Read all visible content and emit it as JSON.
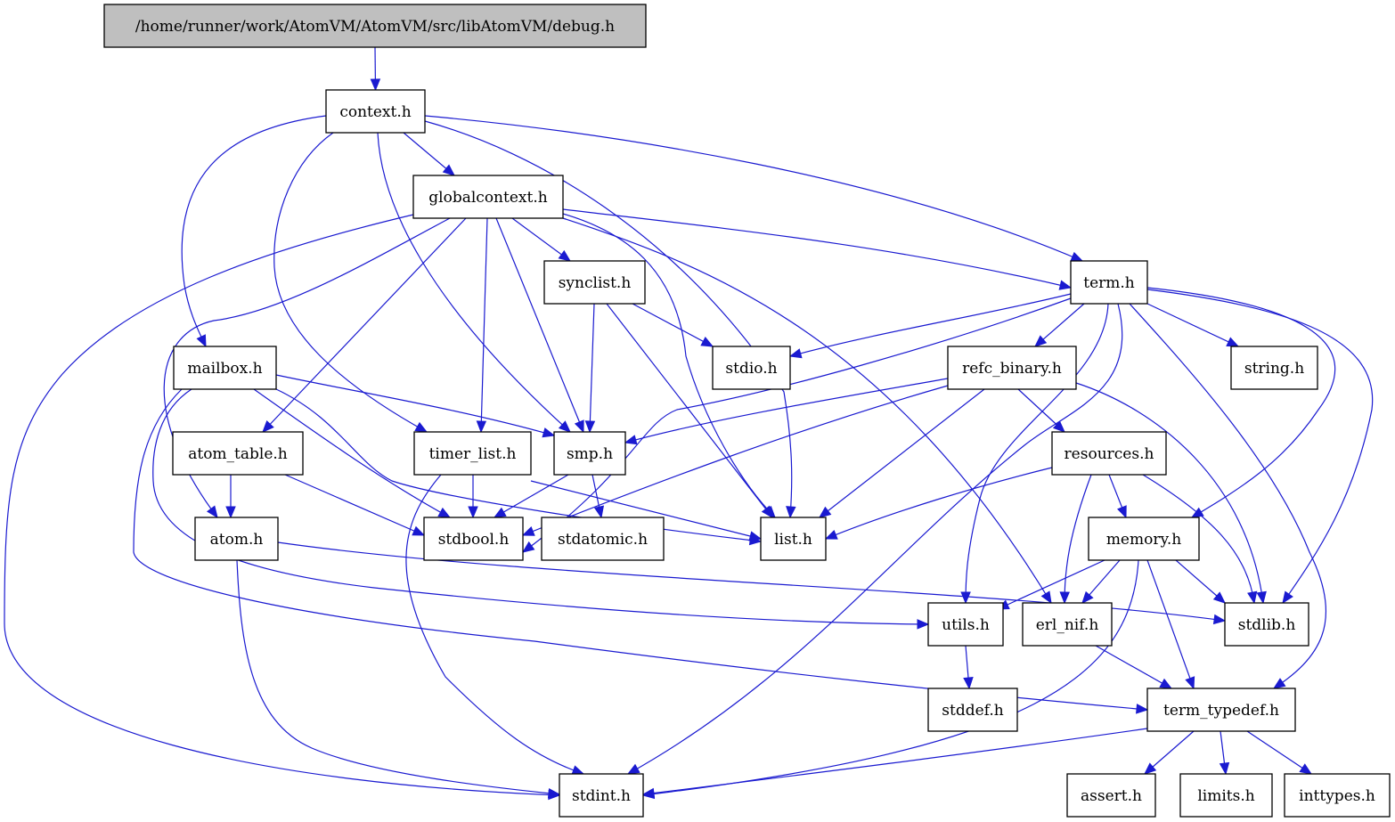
{
  "diagram": {
    "type": "include-dependency-graph",
    "root": "/home/runner/work/AtomVM/AtomVM/src/libAtomVM/debug.h",
    "colors": {
      "edge": "#1a1ad0",
      "root_fill": "#bfbfbf",
      "node_fill": "#ffffff",
      "node_border": "#000000"
    },
    "nodes": [
      {
        "id": "debug",
        "label": "/home/runner/work/AtomVM/AtomVM/src/libAtomVM/debug.h",
        "root": true
      },
      {
        "id": "context",
        "label": "context.h"
      },
      {
        "id": "globalcontext",
        "label": "globalcontext.h"
      },
      {
        "id": "term",
        "label": "term.h"
      },
      {
        "id": "synclist",
        "label": "synclist.h"
      },
      {
        "id": "mailbox",
        "label": "mailbox.h"
      },
      {
        "id": "stdio",
        "label": "stdio.h"
      },
      {
        "id": "refc_binary",
        "label": "refc_binary.h"
      },
      {
        "id": "string",
        "label": "string.h"
      },
      {
        "id": "atom_table",
        "label": "atom_table.h"
      },
      {
        "id": "timer_list",
        "label": "timer_list.h"
      },
      {
        "id": "smp",
        "label": "smp.h"
      },
      {
        "id": "resources",
        "label": "resources.h"
      },
      {
        "id": "atom",
        "label": "atom.h"
      },
      {
        "id": "stdbool",
        "label": "stdbool.h"
      },
      {
        "id": "stdatomic",
        "label": "stdatomic.h"
      },
      {
        "id": "list",
        "label": "list.h"
      },
      {
        "id": "memory",
        "label": "memory.h"
      },
      {
        "id": "utils",
        "label": "utils.h"
      },
      {
        "id": "erl_nif",
        "label": "erl_nif.h"
      },
      {
        "id": "stdlib",
        "label": "stdlib.h"
      },
      {
        "id": "stddef",
        "label": "stddef.h"
      },
      {
        "id": "term_typedef",
        "label": "term_typedef.h"
      },
      {
        "id": "stdint",
        "label": "stdint.h"
      },
      {
        "id": "assert",
        "label": "assert.h"
      },
      {
        "id": "limits",
        "label": "limits.h"
      },
      {
        "id": "inttypes",
        "label": "inttypes.h"
      }
    ],
    "edges": [
      [
        "debug",
        "context"
      ],
      [
        "context",
        "globalcontext"
      ],
      [
        "context",
        "term"
      ],
      [
        "context",
        "mailbox"
      ],
      [
        "context",
        "timer_list"
      ],
      [
        "context",
        "smp"
      ],
      [
        "context",
        "list"
      ],
      [
        "globalcontext",
        "term"
      ],
      [
        "globalcontext",
        "synclist"
      ],
      [
        "globalcontext",
        "atom_table"
      ],
      [
        "globalcontext",
        "timer_list"
      ],
      [
        "globalcontext",
        "smp"
      ],
      [
        "globalcontext",
        "list"
      ],
      [
        "globalcontext",
        "atom"
      ],
      [
        "globalcontext",
        "erl_nif"
      ],
      [
        "globalcontext",
        "stdint"
      ],
      [
        "term",
        "stdio"
      ],
      [
        "term",
        "refc_binary"
      ],
      [
        "term",
        "string"
      ],
      [
        "term",
        "stdbool"
      ],
      [
        "term",
        "memory"
      ],
      [
        "term",
        "utils"
      ],
      [
        "term",
        "stdlib"
      ],
      [
        "term",
        "term_typedef"
      ],
      [
        "term",
        "stdint"
      ],
      [
        "synclist",
        "stdio"
      ],
      [
        "synclist",
        "smp"
      ],
      [
        "synclist",
        "list"
      ],
      [
        "mailbox",
        "smp"
      ],
      [
        "mailbox",
        "stdbool"
      ],
      [
        "mailbox",
        "list"
      ],
      [
        "mailbox",
        "utils"
      ],
      [
        "mailbox",
        "term_typedef"
      ],
      [
        "refc_binary",
        "smp"
      ],
      [
        "refc_binary",
        "stdbool"
      ],
      [
        "refc_binary",
        "list"
      ],
      [
        "refc_binary",
        "resources"
      ],
      [
        "refc_binary",
        "stdlib"
      ],
      [
        "atom_table",
        "atom"
      ],
      [
        "atom_table",
        "stdbool"
      ],
      [
        "timer_list",
        "stdbool"
      ],
      [
        "timer_list",
        "list"
      ],
      [
        "timer_list",
        "stdint"
      ],
      [
        "smp",
        "stdbool"
      ],
      [
        "smp",
        "stdatomic"
      ],
      [
        "resources",
        "list"
      ],
      [
        "resources",
        "memory"
      ],
      [
        "resources",
        "erl_nif"
      ],
      [
        "resources",
        "stdlib"
      ],
      [
        "atom",
        "stdlib"
      ],
      [
        "atom",
        "stdint"
      ],
      [
        "memory",
        "utils"
      ],
      [
        "memory",
        "erl_nif"
      ],
      [
        "memory",
        "stdlib"
      ],
      [
        "memory",
        "term_typedef"
      ],
      [
        "memory",
        "stdint"
      ],
      [
        "utils",
        "stddef"
      ],
      [
        "erl_nif",
        "term_typedef"
      ],
      [
        "term_typedef",
        "stdint"
      ],
      [
        "term_typedef",
        "assert"
      ],
      [
        "term_typedef",
        "limits"
      ],
      [
        "term_typedef",
        "inttypes"
      ]
    ]
  }
}
